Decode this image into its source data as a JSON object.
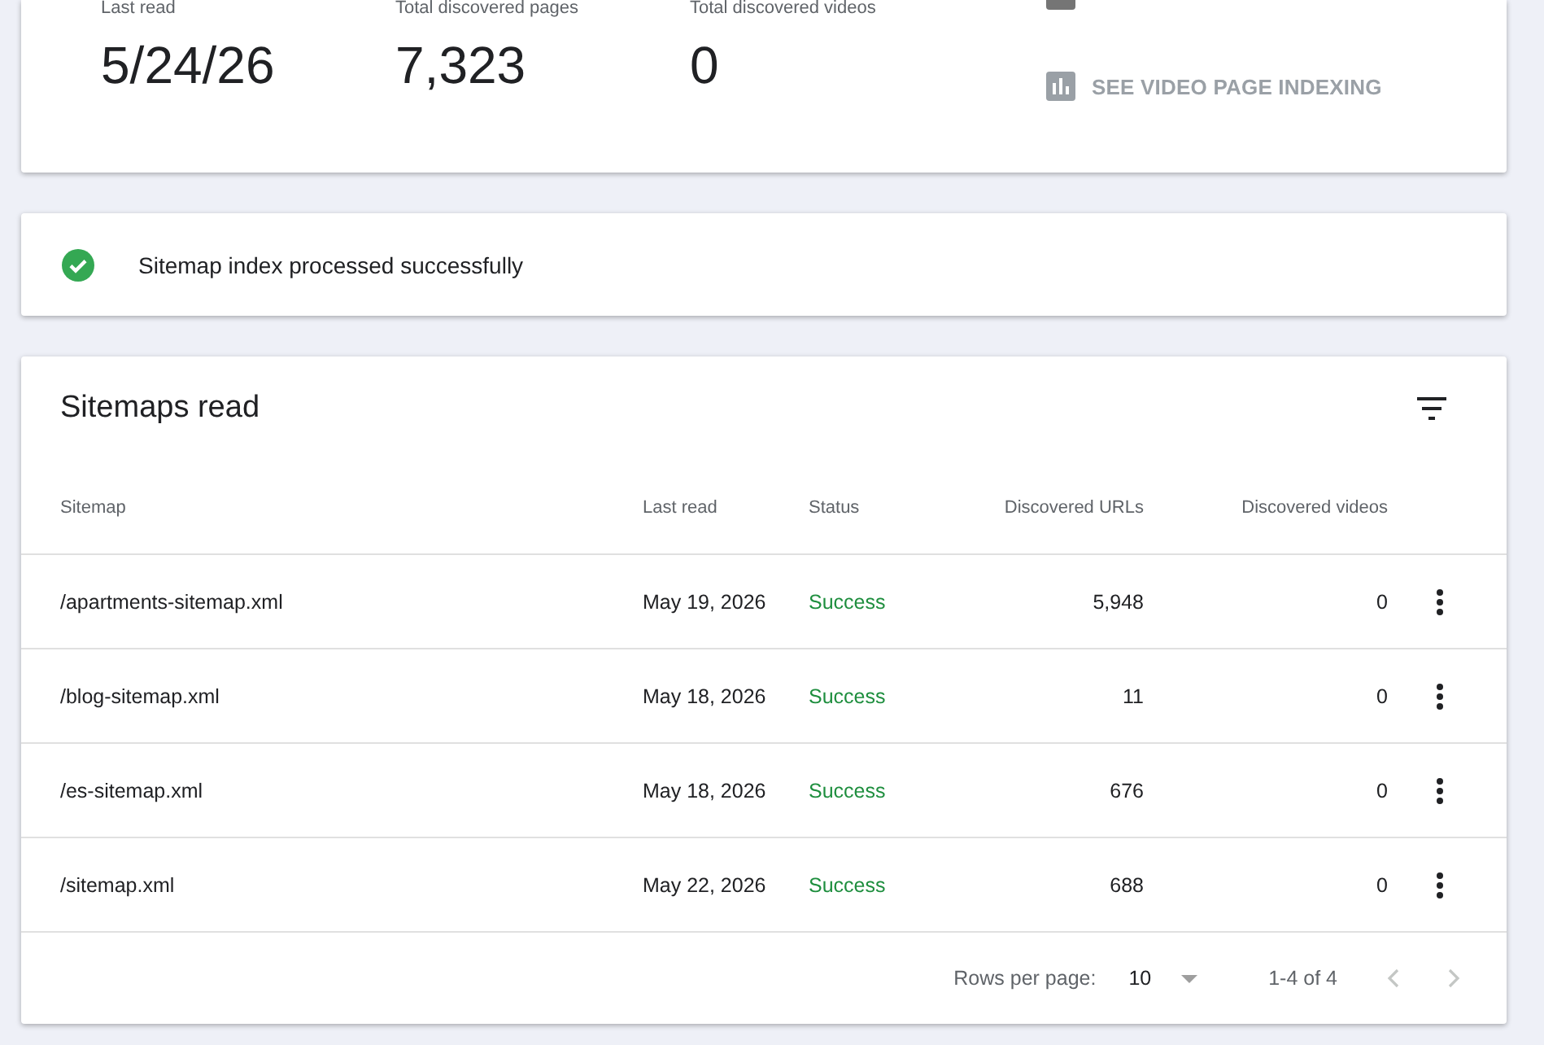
{
  "summary": {
    "stats": [
      {
        "label": "Last read",
        "value": "5/24/26"
      },
      {
        "label": "Total discovered pages",
        "value": "7,323"
      },
      {
        "label": "Total discovered videos",
        "value": "0"
      }
    ],
    "action": "SEE VIDEO PAGE INDEXING"
  },
  "status_banner": {
    "kind": "success",
    "text": "Sitemap index processed successfully"
  },
  "sitemaps": {
    "title": "Sitemaps read",
    "columns": [
      "Sitemap",
      "Last read",
      "Status",
      "Discovered URLs",
      "Discovered videos"
    ],
    "rows": [
      {
        "sitemap": "/apartments-sitemap.xml",
        "last_read": "May 19, 2026",
        "status": "Success",
        "kind": "success",
        "urls": "5,948",
        "videos": "0"
      },
      {
        "sitemap": "/blog-sitemap.xml",
        "last_read": "May 18, 2026",
        "status": "Success",
        "kind": "success",
        "urls": "11",
        "videos": "0"
      },
      {
        "sitemap": "/es-sitemap.xml",
        "last_read": "May 18, 2026",
        "status": "Success",
        "kind": "success",
        "urls": "676",
        "videos": "0"
      },
      {
        "sitemap": "/sitemap.xml",
        "last_read": "May 22, 2026",
        "status": "Success",
        "kind": "success",
        "urls": "688",
        "videos": "0"
      }
    ],
    "pagination": {
      "rows_per_page_label": "Rows per page:",
      "rows_per_page": "10",
      "range": "1-4 of 4",
      "prev_disabled": true,
      "next_disabled": true
    }
  }
}
